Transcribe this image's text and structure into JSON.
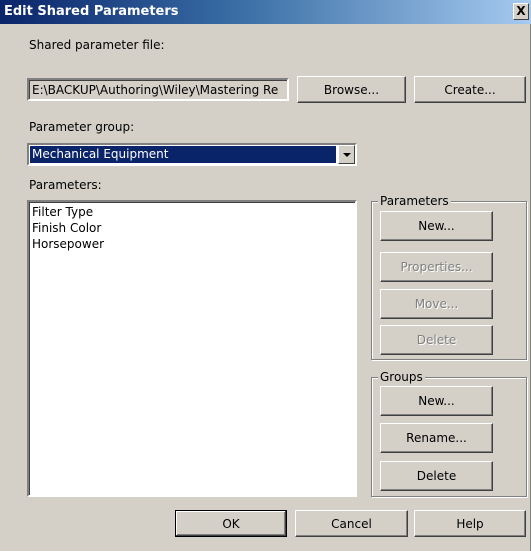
{
  "window": {
    "title": "Edit Shared Parameters",
    "close_label": "X"
  },
  "shared_file": {
    "label": "Shared parameter file:",
    "value": "E:\\BACKUP\\Authoring\\Wiley\\Mastering Re",
    "browse_label": "Browse...",
    "create_label": "Create..."
  },
  "parameter_group": {
    "label": "Parameter group:",
    "selected": "Mechanical Equipment"
  },
  "parameters_list": {
    "label": "Parameters:",
    "items": [
      "Filter Type",
      "Finish Color",
      "Horsepower"
    ]
  },
  "parameters_box": {
    "title": "Parameters",
    "new_label": "New...",
    "properties_label": "Properties...",
    "move_label": "Move...",
    "delete_label": "Delete"
  },
  "groups_box": {
    "title": "Groups",
    "new_label": "New...",
    "rename_label": "Rename...",
    "delete_label": "Delete"
  },
  "footer": {
    "ok_label": "OK",
    "cancel_label": "Cancel",
    "help_label": "Help"
  }
}
